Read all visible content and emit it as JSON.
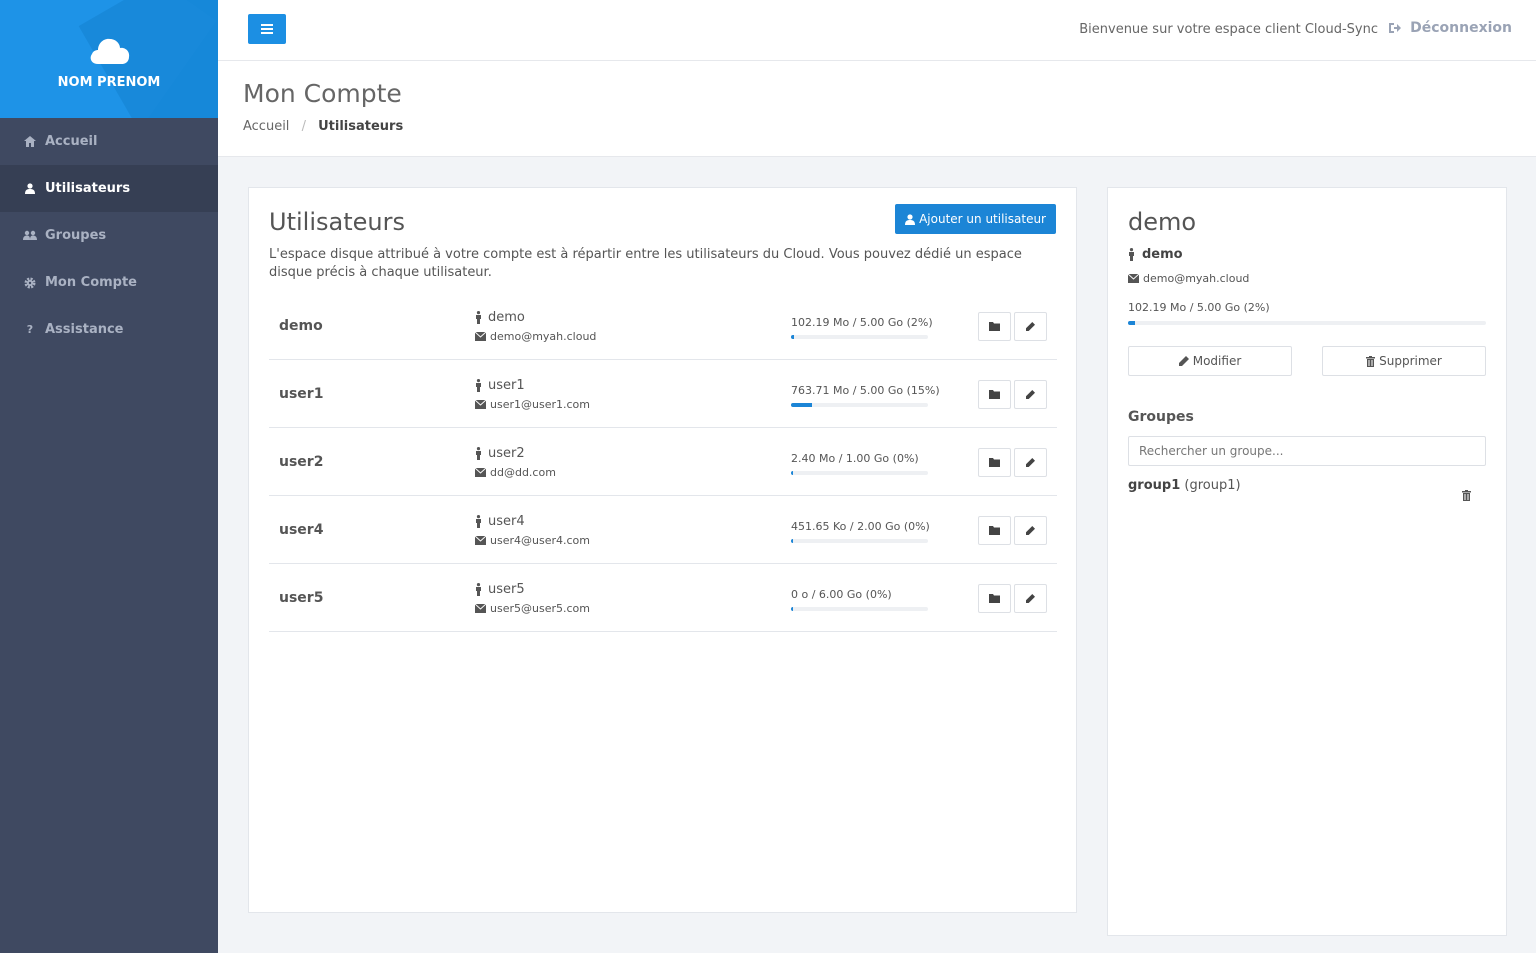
{
  "sidebar": {
    "user_name": "NOM PRENOM",
    "items": [
      {
        "label": "Accueil",
        "icon": "home-icon",
        "active": false
      },
      {
        "label": "Utilisateurs",
        "icon": "user-icon",
        "active": true
      },
      {
        "label": "Groupes",
        "icon": "users-icon",
        "active": false
      },
      {
        "label": "Mon Compte",
        "icon": "gear-icon",
        "active": false
      },
      {
        "label": "Assistance",
        "icon": "question-icon",
        "active": false
      }
    ]
  },
  "header": {
    "welcome": "Bienvenue sur votre espace client Cloud-Sync",
    "logout_label": "Déconnexion"
  },
  "page": {
    "title": "Mon Compte",
    "breadcrumb": {
      "home": "Accueil",
      "current": "Utilisateurs"
    }
  },
  "users_panel": {
    "title": "Utilisateurs",
    "add_button": "Ajouter un utilisateur",
    "description": "L'espace disque attribué à votre compte est à répartir entre les utilisateurs du Cloud. Vous pouvez dédié un espace disque précis à chaque utilisateur.",
    "users": [
      {
        "name": "demo",
        "login": "demo",
        "email": "demo@myah.cloud",
        "quota": "102.19 Mo / 5.00 Go (2%)",
        "percent": 2
      },
      {
        "name": "user1",
        "login": "user1",
        "email": "user1@user1.com",
        "quota": "763.71 Mo / 5.00 Go (15%)",
        "percent": 15
      },
      {
        "name": "user2",
        "login": "user2",
        "email": "dd@dd.com",
        "quota": "2.40 Mo / 1.00 Go (0%)",
        "percent": 0
      },
      {
        "name": "user4",
        "login": "user4",
        "email": "user4@user4.com",
        "quota": "451.65 Ko / 2.00 Go (0%)",
        "percent": 0
      },
      {
        "name": "user5",
        "login": "user5",
        "email": "user5@user5.com",
        "quota": "0 o / 6.00 Go (0%)",
        "percent": 0
      }
    ]
  },
  "detail_panel": {
    "title": "demo",
    "login": "demo",
    "email": "demo@myah.cloud",
    "quota": "102.19 Mo / 5.00 Go (2%)",
    "percent": 2,
    "modify_label": "Modifier",
    "delete_label": "Supprimer",
    "groups_title": "Groupes",
    "search_placeholder": "Rechercher un groupe...",
    "groups": [
      {
        "name": "group1",
        "id": "(group1)"
      }
    ]
  },
  "colors": {
    "accent": "#1c85d6",
    "sidebar": "#3f4961",
    "brand": "#1a8fe3"
  }
}
